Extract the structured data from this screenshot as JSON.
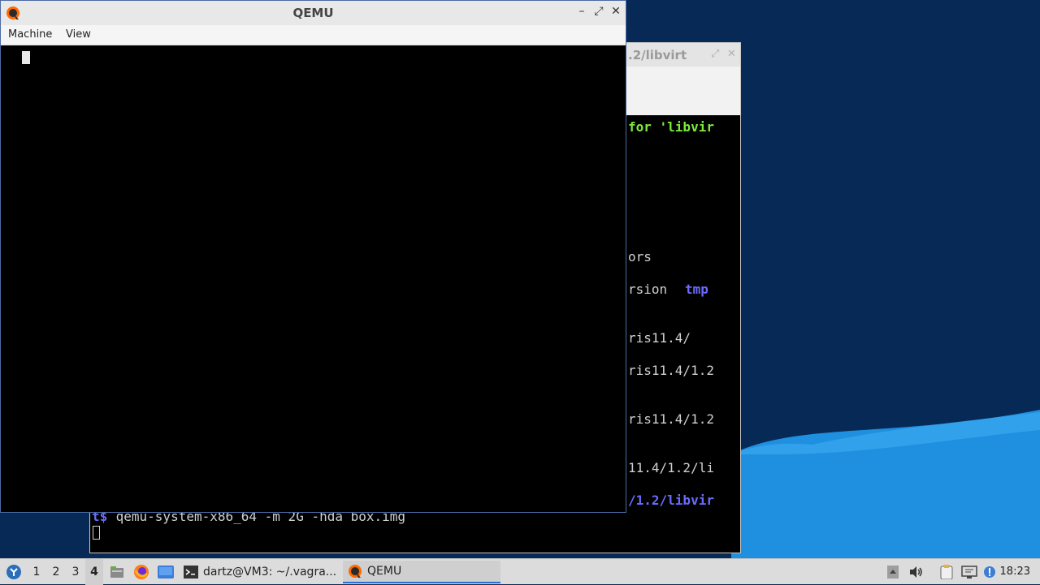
{
  "qemu_window": {
    "title": "QEMU",
    "menu": [
      "Machine",
      "View"
    ],
    "controls": {
      "minimize": "–",
      "maximize": "⤢",
      "close": "✕"
    }
  },
  "terminal_window": {
    "title_partial": ".2/libvirt",
    "lines": [
      {
        "text": "for 'libvir",
        "style": "green"
      },
      {
        "text": "ors",
        "style": "normal"
      },
      {
        "text": "rsion  ",
        "style": "normal",
        "extra": "tmp"
      },
      {
        "text": "ris11.4/",
        "style": "normal"
      },
      {
        "text": "ris11.4/1.2",
        "style": "normal"
      },
      {
        "text": "ris11.4/1.2",
        "style": "normal"
      },
      {
        "text": "11.4/1.2/li",
        "style": "normal"
      },
      {
        "text": "/1.2/libvir",
        "style": "blue"
      }
    ],
    "prompt_symbol": "t$",
    "command": " qemu-system-x86_64 -m 2G -hda box.img"
  },
  "taskbar": {
    "workspaces": [
      "1",
      "2",
      "3",
      "4"
    ],
    "active_workspace": "4",
    "tasks": [
      {
        "label": "dartz@VM3: ~/.vagra...",
        "icon": "terminal-icon"
      },
      {
        "label": "QEMU",
        "icon": "qemu-icon",
        "active": true
      }
    ],
    "clock": "18:23"
  }
}
